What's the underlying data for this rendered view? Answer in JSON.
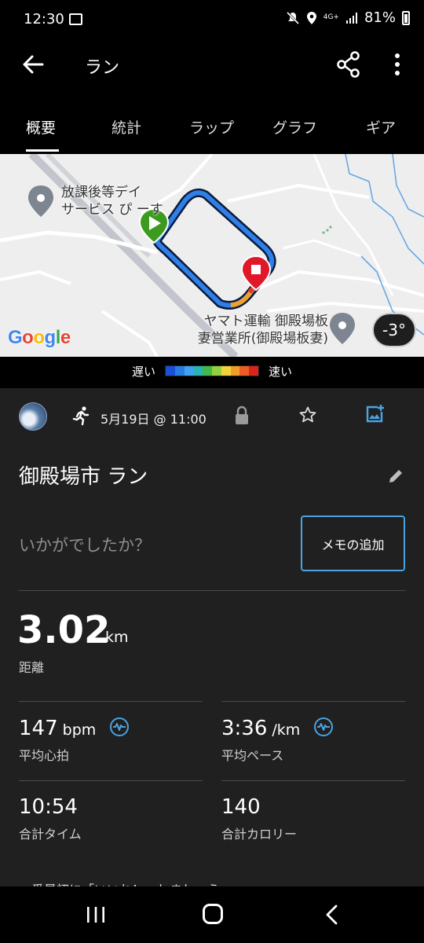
{
  "status": {
    "time": "12:30",
    "network": "4G+",
    "battery": "81%"
  },
  "app_bar": {
    "title": "ラン",
    "icons": [
      "back-arrow-icon",
      "share-icon",
      "more-vert-icon"
    ]
  },
  "tabs": [
    {
      "label": "概要",
      "active": true
    },
    {
      "label": "統計",
      "active": false
    },
    {
      "label": "ラップ",
      "active": false
    },
    {
      "label": "グラフ",
      "active": false
    },
    {
      "label": "ギア",
      "active": false
    }
  ],
  "map": {
    "places": [
      {
        "line1": "放課後等デイ",
        "line2": "サービス ぴ ーす"
      },
      {
        "line1": "ヤマト運輸 御殿場板",
        "line2": "妻営業所(御殿場板妻)"
      }
    ],
    "temperature": "-3°",
    "provider": "Google",
    "provider_colors": [
      "#4285F4",
      "#EA4335",
      "#FBBC05",
      "#4285F4",
      "#34A853",
      "#EA4335"
    ]
  },
  "speed_legend": {
    "slow": "遅い",
    "fast": "速い",
    "colors": [
      "#1a4fd8",
      "#2a7be6",
      "#3fa1f0",
      "#29b3b3",
      "#43b84a",
      "#8fd13f",
      "#f0d23b",
      "#f39b2a",
      "#ee5d25",
      "#d9241e"
    ]
  },
  "activity": {
    "date": "5月19日 @ 11:00",
    "title": "御殿場市 ラン",
    "feeling_placeholder": "いかがでしたか？",
    "memo_button": "メモの追加"
  },
  "stats": {
    "distance": {
      "value": "3.02",
      "unit": "km",
      "label": "距離"
    },
    "avg_hr": {
      "value": "147",
      "unit": "bpm",
      "label": "平均心拍"
    },
    "avg_pace": {
      "value": "3:36",
      "unit": "/km",
      "label": "平均ペース"
    },
    "total_time": {
      "value": "10:54",
      "label": "合計タイム"
    },
    "total_calories": {
      "value": "140",
      "label": "合計カロリー"
    }
  },
  "cut_text": "一番最初に「いいね！」しましょう"
}
